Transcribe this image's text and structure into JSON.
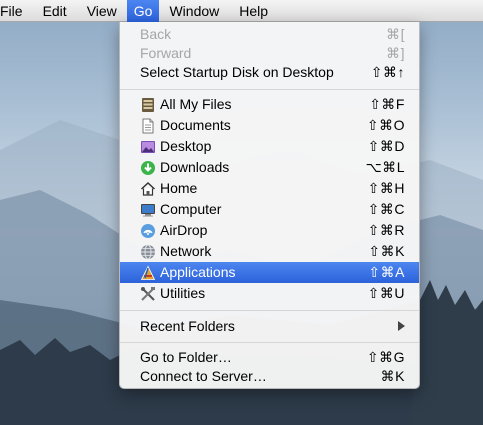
{
  "menubar": {
    "items": [
      {
        "label": "File"
      },
      {
        "label": "Edit"
      },
      {
        "label": "View"
      },
      {
        "label": "Go"
      },
      {
        "label": "Window"
      },
      {
        "label": "Help"
      }
    ],
    "active_index": 3
  },
  "go_menu": {
    "nav": [
      {
        "label": "Back",
        "shortcut": "⌘[",
        "enabled": false
      },
      {
        "label": "Forward",
        "shortcut": "⌘]",
        "enabled": false
      },
      {
        "label": "Select Startup Disk on Desktop",
        "shortcut": "⇧⌘↑",
        "enabled": true
      }
    ],
    "places": [
      {
        "label": "All My Files",
        "shortcut": "⇧⌘F",
        "icon": "all-my-files-icon"
      },
      {
        "label": "Documents",
        "shortcut": "⇧⌘O",
        "icon": "documents-icon"
      },
      {
        "label": "Desktop",
        "shortcut": "⇧⌘D",
        "icon": "desktop-icon"
      },
      {
        "label": "Downloads",
        "shortcut": "⌥⌘L",
        "icon": "downloads-icon"
      },
      {
        "label": "Home",
        "shortcut": "⇧⌘H",
        "icon": "home-icon"
      },
      {
        "label": "Computer",
        "shortcut": "⇧⌘C",
        "icon": "computer-icon"
      },
      {
        "label": "AirDrop",
        "shortcut": "⇧⌘R",
        "icon": "airdrop-icon"
      },
      {
        "label": "Network",
        "shortcut": "⇧⌘K",
        "icon": "network-icon"
      },
      {
        "label": "Applications",
        "shortcut": "⇧⌘A",
        "icon": "applications-icon",
        "selected": true
      },
      {
        "label": "Utilities",
        "shortcut": "⇧⌘U",
        "icon": "utilities-icon"
      }
    ],
    "recent": {
      "label": "Recent Folders"
    },
    "folder_actions": [
      {
        "label": "Go to Folder…",
        "shortcut": "⇧⌘G"
      },
      {
        "label": "Connect to Server…",
        "shortcut": "⌘K"
      }
    ]
  },
  "colors": {
    "highlight": "#2f66e0",
    "disabled_text": "#a6a6a6"
  }
}
